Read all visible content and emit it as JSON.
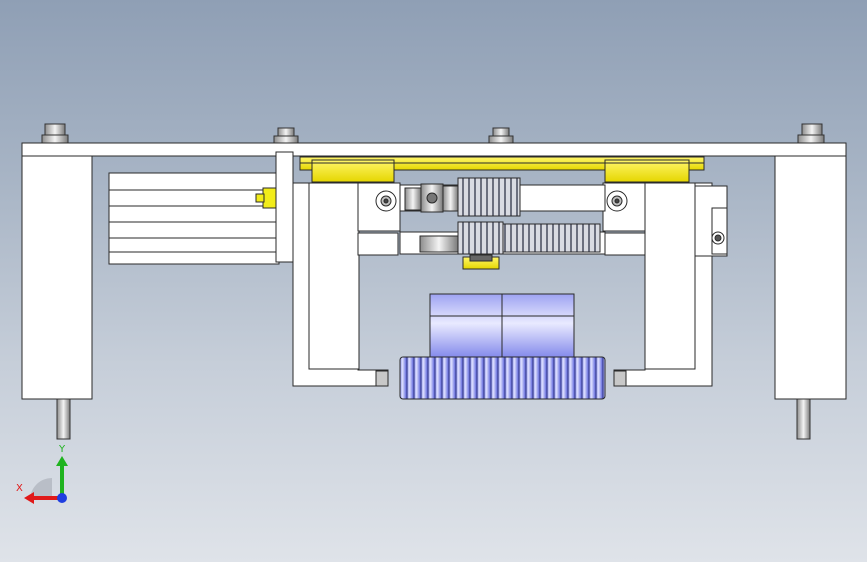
{
  "viewport": {
    "background_top": "#8f9fb5",
    "background_bottom": "#dfe3e9"
  },
  "model": {
    "part_fill": "#ffffff",
    "part_stroke": "#2a2a2a",
    "rail_color": "#f2ec1a",
    "gear_color": "#8a8ff0",
    "hub_color": "#b8bcf5"
  },
  "triad": {
    "x_label": "X",
    "y_label": "Y",
    "x_color": "#e01919",
    "y_color": "#1fb31f",
    "z_color": "#1f3ee0"
  }
}
